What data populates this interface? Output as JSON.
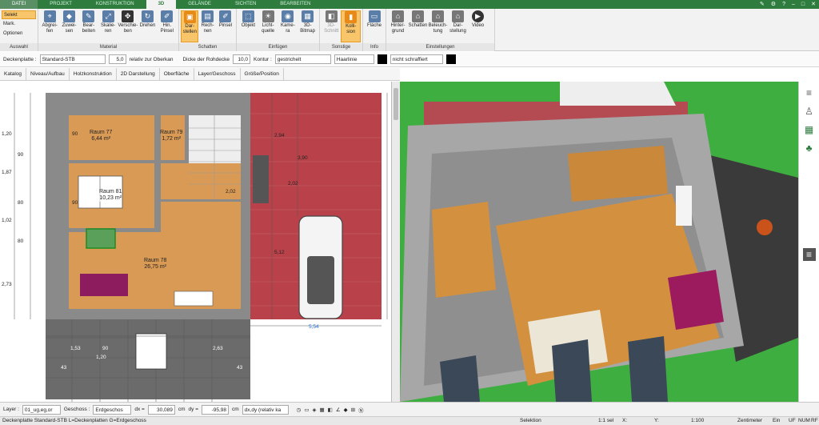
{
  "tabs": [
    "DATEI",
    "PROJEKT",
    "KONSTRUKTION",
    "3D",
    "GELÄNDE",
    "SICHTEN",
    "BEARBEITEN"
  ],
  "ribbon": {
    "auswahl": {
      "label": "Auswahl",
      "items": [
        "Selekt",
        "Mark.",
        "Optionen"
      ]
    },
    "material": {
      "label": "Material",
      "buttons": [
        "Abgrei-\nfen",
        "Zuwei-\nsen",
        "Bear-\nbeiten",
        "Skalie-\nren",
        "Verschie-\nben",
        "Drehen",
        "Hin.\nPinsel"
      ]
    },
    "schatten": {
      "label": "Schatten",
      "buttons": [
        "Dar-\nstellen",
        "Rech-\nnen",
        "Pinsel"
      ]
    },
    "einfuegen": {
      "label": "Einfügen",
      "buttons": [
        "Objekt",
        "Licht-\nquelle",
        "Kame-\nra",
        "3D-\nBitmap"
      ]
    },
    "sonstige": {
      "label": "Sonstige",
      "buttons": [
        "3D-\nSchnitt",
        "Kolli-\nsion"
      ]
    },
    "info": {
      "label": "Info",
      "buttons": [
        "Fläche"
      ]
    },
    "einstellungen": {
      "label": "Einstellungen",
      "buttons": [
        "Hinter-\ngrund",
        "Schatten",
        "Beleuch-\ntung",
        "Dar-\nstellung",
        "Video"
      ]
    }
  },
  "props": {
    "deckenplatte_label": "Deckenplatte :",
    "deckenplatte_value": "Standard-STB",
    "offset_value": "5,0",
    "offset_label": "relativ zur Oberkan",
    "dicke_label": "Dicke der Rohdecke",
    "dicke_value": "10,0",
    "kontur_label": "Kontur :",
    "kontur_value": "gestrichelt",
    "haarlinie": "Haarlinie",
    "fill_label": "nicht schraffiert"
  },
  "tools": [
    "Katalog",
    "Niveau/Aufbau",
    "Holzkonstruktion",
    "2D Darstellung",
    "Oberfläche",
    "Layer/Geschoss",
    "Größe/Position"
  ],
  "rooms": [
    {
      "name": "Raum 77",
      "area": "6,44 m²"
    },
    {
      "name": "Raum 79",
      "area": "1,72 m²"
    },
    {
      "name": "Raum 81",
      "area": "10,23 m²"
    },
    {
      "name": "Raum 78",
      "area": "26,75 m²"
    }
  ],
  "dims": {
    "left": [
      "1,20",
      "1,87",
      "1,02",
      "2,73"
    ],
    "left2": [
      "90",
      "80",
      "80"
    ],
    "bottom": [
      "1,53",
      "90",
      "1,20",
      "2,63",
      "43",
      "43"
    ],
    "drive_width": "5,54",
    "drive_v": [
      "2,94",
      "3,90",
      "2,02",
      "5,12"
    ],
    "misc": [
      "2,02",
      "90",
      "90"
    ]
  },
  "bottom": {
    "layer_label": "Layer :",
    "layer_value": "01_ug,eg,or",
    "geschoss_label": "Geschoss :",
    "geschoss_value": "Erdgeschos",
    "dx_label": "dx =",
    "dx_value": "30,089",
    "dx_unit": "cm",
    "dy_label": "dy =",
    "dy_value": "-95,98",
    "dy_unit": "cm",
    "mode": "dx,dy (relativ ka"
  },
  "status": {
    "left": "Deckenplatte Standard-STB L=Deckenplatten G=Erdgeschoss",
    "sel": "Selektion",
    "scale": "1:1 sel",
    "x": "X:",
    "y": "Y:",
    "ratio": "1:100",
    "unit": "Zentimeter",
    "ein": "Ein",
    "uf": "UF",
    "num": "NUM",
    "rf": "RF"
  }
}
